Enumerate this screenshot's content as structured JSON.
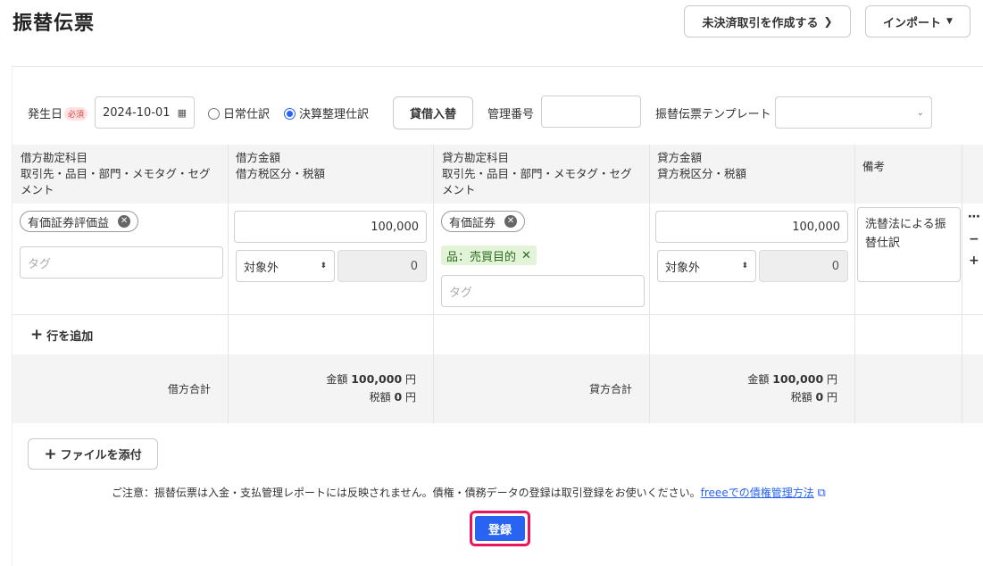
{
  "page": {
    "title": "振替伝票"
  },
  "header": {
    "unsettled_label": "未決済取引を作成する",
    "import_label": "インポート"
  },
  "form": {
    "date_label": "発生日",
    "required_badge": "必須",
    "date_value": "2024-10-01",
    "radio_normal": "日常仕訳",
    "radio_closing": "決算整理仕訳",
    "radio_selected": "closing",
    "swap_label": "貸借入替",
    "mgmt_no_label": "管理番号",
    "mgmt_no_value": "",
    "template_label": "振替伝票テンプレート",
    "template_value": ""
  },
  "table": {
    "headers": {
      "debit_account": [
        "借方勘定科目",
        "取引先・品目・部門・メモタグ・セグ",
        "メント"
      ],
      "debit_amount": [
        "借方金額",
        "借方税区分・税額"
      ],
      "credit_account": [
        "貸方勘定科目",
        "取引先・品目・部門・メモタグ・セグ",
        "メント"
      ],
      "credit_amount": [
        "貸方金額",
        "貸方税区分・税額"
      ],
      "remarks": [
        "備考"
      ]
    },
    "row": {
      "debit_account": "有価証券評価益",
      "debit_tag_placeholder": "タグ",
      "debit_amount": "100,000",
      "debit_tax_class": "対象外",
      "debit_tax": "0",
      "credit_account": "有価証券",
      "credit_item_tag": "品：売買目的",
      "credit_tag_placeholder": "タグ",
      "credit_amount": "100,000",
      "credit_tax_class": "対象外",
      "credit_tax": "0",
      "remarks": "洗替法による振替仕訳"
    },
    "add_row_label": "行を追加",
    "totals": {
      "debit_label": "借方合計",
      "credit_label": "貸方合計",
      "amount_label": "金額",
      "tax_label": "税額",
      "debit_amount": "100,000",
      "debit_tax": "0",
      "credit_amount": "100,000",
      "credit_tax": "0",
      "yen": "円"
    }
  },
  "attach_label": "ファイルを添付",
  "notice": {
    "text": "ご注意：振替伝票は入金・支払管理レポートには反映されません。債権・債務データの登録は取引登録をお使いください。",
    "link": "freeeでの債権管理方法"
  },
  "submit_label": "登録",
  "colors": {
    "accent": "#2864f0",
    "highlight": "#e8175d"
  }
}
